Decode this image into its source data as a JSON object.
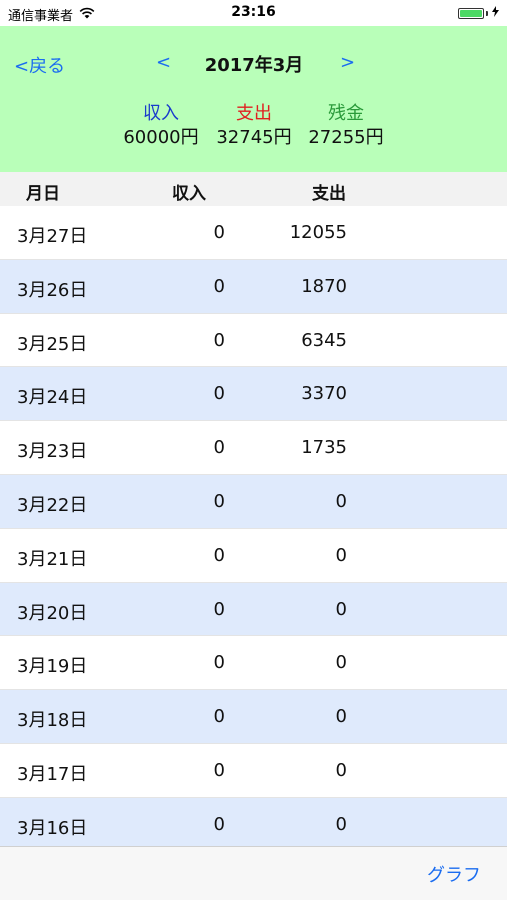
{
  "status_bar": {
    "carrier": "通信事業者",
    "time": "23:16",
    "icons": [
      "wifi-icon",
      "battery-icon",
      "charging-bolt-icon"
    ]
  },
  "header": {
    "back_label": "<戻る",
    "prev_label": "<",
    "next_label": ">",
    "month_title": "2017年3月",
    "summary": {
      "income_label": "収入",
      "income_value": "60000円",
      "expense_label": "支出",
      "expense_value": "32745円",
      "balance_label": "残金",
      "balance_value": "27255円"
    }
  },
  "colors": {
    "header_bg": "#b9ffb9",
    "income": "#1a3ccc",
    "expense": "#e02020",
    "balance": "#2a9a3a",
    "link": "#1a6cf0",
    "alt_row": "#dfeafc"
  },
  "table": {
    "columns": [
      "月日",
      "収入",
      "支出"
    ],
    "rows": [
      {
        "date": "3月27日",
        "income": "0",
        "expense": "12055"
      },
      {
        "date": "3月26日",
        "income": "0",
        "expense": "1870"
      },
      {
        "date": "3月25日",
        "income": "0",
        "expense": "6345"
      },
      {
        "date": "3月24日",
        "income": "0",
        "expense": "3370"
      },
      {
        "date": "3月23日",
        "income": "0",
        "expense": "1735"
      },
      {
        "date": "3月22日",
        "income": "0",
        "expense": "0"
      },
      {
        "date": "3月21日",
        "income": "0",
        "expense": "0"
      },
      {
        "date": "3月20日",
        "income": "0",
        "expense": "0"
      },
      {
        "date": "3月19日",
        "income": "0",
        "expense": "0"
      },
      {
        "date": "3月18日",
        "income": "0",
        "expense": "0"
      },
      {
        "date": "3月17日",
        "income": "0",
        "expense": "0"
      },
      {
        "date": "3月16日",
        "income": "0",
        "expense": "0"
      }
    ]
  },
  "toolbar": {
    "graph_label": "グラフ"
  }
}
